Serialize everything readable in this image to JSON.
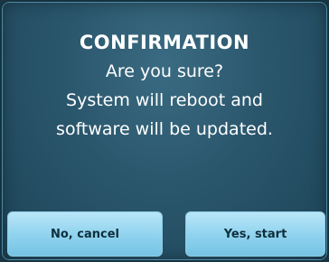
{
  "dialog": {
    "title": "CONFIRMATION",
    "message_lines": [
      "Are you sure?",
      "System will reboot and",
      "software will be updated."
    ],
    "buttons": {
      "cancel_label": "No, cancel",
      "confirm_label": "Yes, start"
    }
  },
  "colors": {
    "dialog_background": "#2a566c",
    "button_background": "#8ed2ee",
    "button_text": "#0f2f3d",
    "text": "#ffffff"
  }
}
